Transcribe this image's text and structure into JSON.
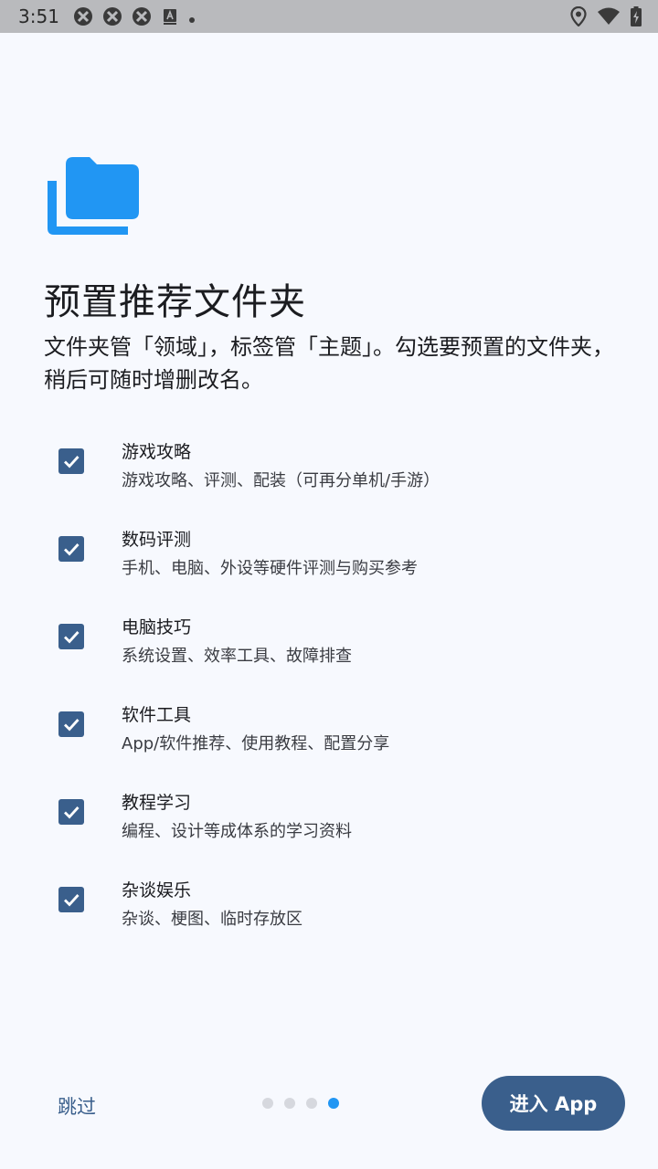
{
  "status_bar": {
    "time": "3:51",
    "left_icons": [
      "app-notification-icon",
      "app-notification-icon",
      "app-notification-icon",
      "keyboard-a-icon",
      "dot-icon"
    ],
    "right_icons": [
      "location-icon",
      "wifi-icon",
      "battery-charging-icon"
    ]
  },
  "header": {
    "icon": "folder-stack-icon",
    "title": "预置推荐文件夹",
    "description": "文件夹管「领域」，标签管「主题」。勾选要预置的文件夹，稍后可随时增删改名。"
  },
  "folders": [
    {
      "title": "游戏攻略",
      "desc": "游戏攻略、评测、配装（可再分单机/手游）",
      "checked": true
    },
    {
      "title": "数码评测",
      "desc": "手机、电脑、外设等硬件评测与购买参考",
      "checked": true
    },
    {
      "title": "电脑技巧",
      "desc": "系统设置、效率工具、故障排查",
      "checked": true
    },
    {
      "title": "软件工具",
      "desc": "App/软件推荐、使用教程、配置分享",
      "checked": true
    },
    {
      "title": "教程学习",
      "desc": "编程、设计等成体系的学习资料",
      "checked": true
    },
    {
      "title": "杂谈娱乐",
      "desc": "杂谈、梗图、临时存放区",
      "checked": true
    }
  ],
  "footer": {
    "skip_label": "跳过",
    "page_count": 4,
    "active_page": 4,
    "enter_label": "进入 App"
  },
  "colors": {
    "background": "#f7f9fe",
    "accent": "#3a5f8c",
    "icon_blue": "#2196f3",
    "status_bar": "#b9babd"
  }
}
